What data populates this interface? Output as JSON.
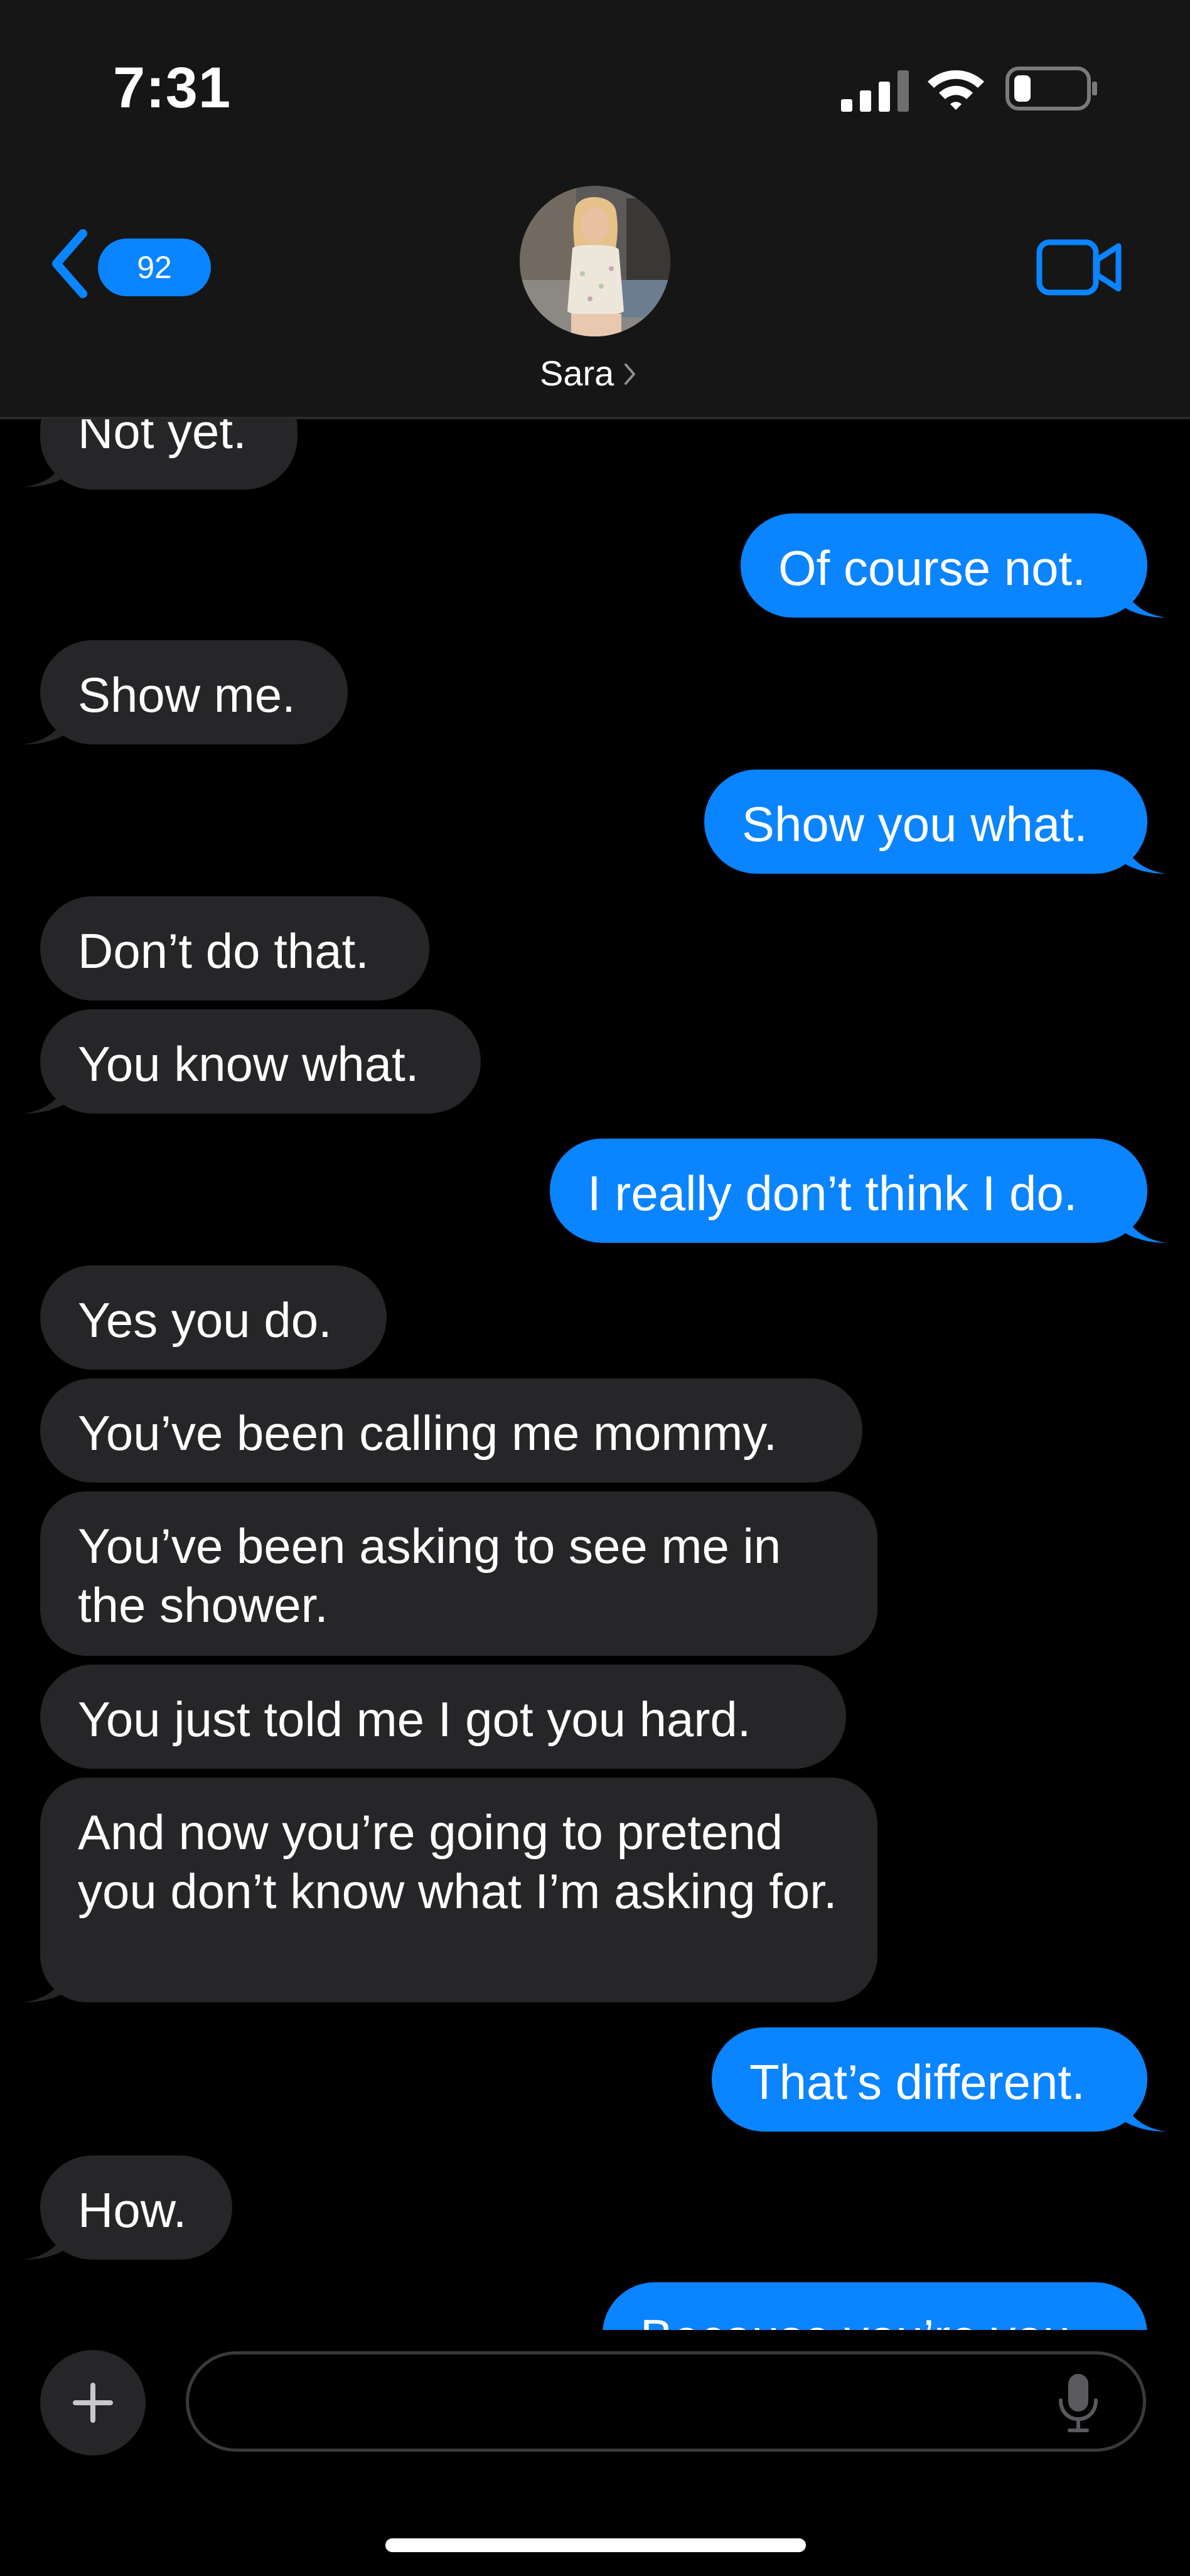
{
  "status_bar": {
    "time": "7:31"
  },
  "header": {
    "back_badge": "92",
    "contact_name": "Sara",
    "icons": {
      "back": "chevron-left-icon",
      "video": "video-camera-icon",
      "contact_chevron": "chevron-right-icon"
    }
  },
  "colors": {
    "outgoing_bubble": "#0a84ff",
    "incoming_bubble": "#262628",
    "header_bg": "#161616",
    "background": "#000000"
  },
  "messages": [
    {
      "direction": "incoming",
      "text": "Not yet."
    },
    {
      "direction": "outgoing",
      "text": "Of course not."
    },
    {
      "direction": "incoming",
      "text": "Show me."
    },
    {
      "direction": "outgoing",
      "text": "Show you what."
    },
    {
      "direction": "incoming",
      "text": "Don’t do that."
    },
    {
      "direction": "incoming",
      "text": "You know what."
    },
    {
      "direction": "outgoing",
      "text": "I really don’t think I do."
    },
    {
      "direction": "incoming",
      "text": "Yes you do."
    },
    {
      "direction": "incoming",
      "text": "You’ve been calling me mommy."
    },
    {
      "direction": "incoming",
      "text": "You’ve been asking to see me in the shower."
    },
    {
      "direction": "incoming",
      "text": "You just told me I got you hard."
    },
    {
      "direction": "incoming",
      "text": "And now you’re going to pretend you don’t know what I’m asking for."
    },
    {
      "direction": "outgoing",
      "text": "That’s different."
    },
    {
      "direction": "incoming",
      "text": "How."
    },
    {
      "direction": "outgoing",
      "text": "Because you’re you"
    }
  ],
  "composer": {
    "placeholder": "",
    "icons": {
      "add": "plus-icon",
      "mic": "microphone-icon"
    }
  }
}
